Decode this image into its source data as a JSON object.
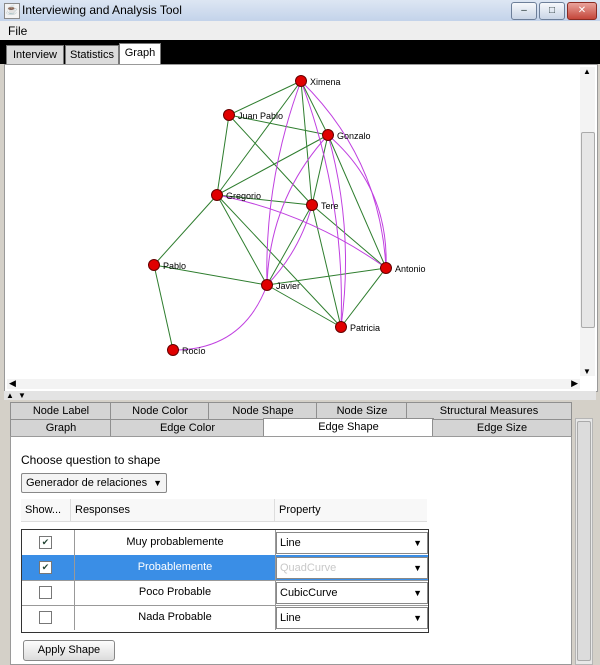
{
  "window": {
    "title": "Interviewing and Analysis Tool",
    "icon": "java-app-icon",
    "controls": {
      "minimize": "–",
      "maximize": "□",
      "close": "✕"
    }
  },
  "menu": {
    "file": "File"
  },
  "main_tabs": [
    "Interview",
    "Statistics",
    "Graph"
  ],
  "graph": {
    "node_color": "#e00000",
    "edge_colors": {
      "green": "#2e7d2e",
      "purple": "#c040e0"
    },
    "nodes": [
      {
        "id": "ximena",
        "label": "Ximena"
      },
      {
        "id": "juanpablo",
        "label": "Juan Pablo"
      },
      {
        "id": "gonzalo",
        "label": "Gonzalo"
      },
      {
        "id": "gregorio",
        "label": "Gregorio"
      },
      {
        "id": "tere",
        "label": "Tere"
      },
      {
        "id": "pablo",
        "label": "Pablo"
      },
      {
        "id": "javier",
        "label": "Javier"
      },
      {
        "id": "antonio",
        "label": "Antonio"
      },
      {
        "id": "patricia",
        "label": "Patricia"
      },
      {
        "id": "rocio",
        "label": "Rocío"
      }
    ]
  },
  "settings_tabs": {
    "row1": [
      "Node Label",
      "Node Color",
      "Node Shape",
      "Node Size",
      "Structural Measures"
    ],
    "row2": [
      "Graph",
      "Edge Color",
      "Edge Shape",
      "Edge Size"
    ],
    "active": "Edge Shape"
  },
  "edge_shape": {
    "choose_label": "Choose question to shape",
    "question_combo": "Generador de relaciones",
    "columns": [
      "Show...",
      "Responses",
      "Property"
    ],
    "rows": [
      {
        "show": true,
        "response": "Muy probablemente",
        "property": "Line"
      },
      {
        "show": true,
        "response": "Probablemente",
        "property": "QuadCurve"
      },
      {
        "show": false,
        "response": "Poco Probable",
        "property": "CubicCurve"
      },
      {
        "show": false,
        "response": "Nada Probable",
        "property": "Line"
      }
    ],
    "apply_button": "Apply Shape"
  }
}
